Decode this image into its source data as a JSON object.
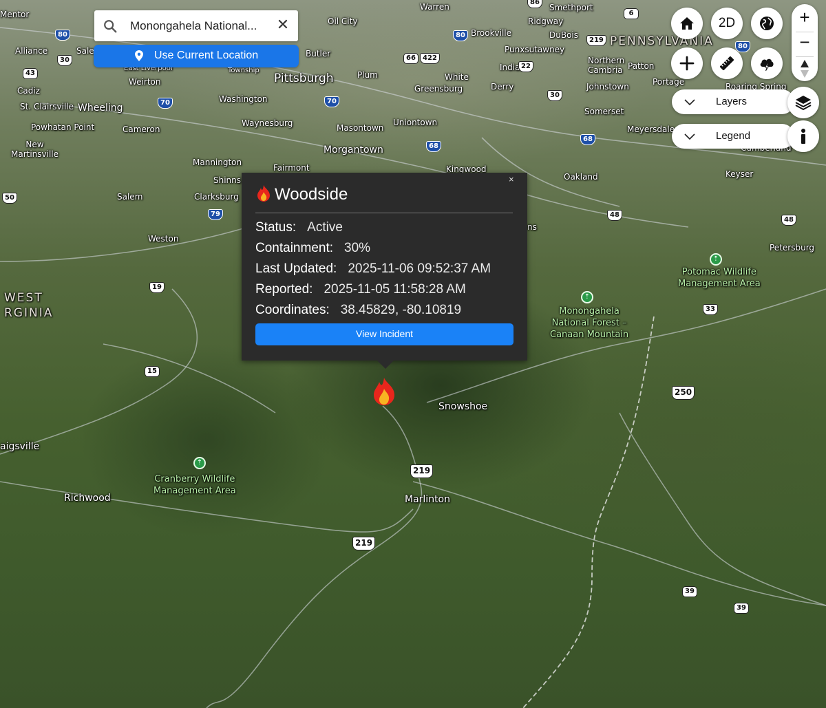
{
  "search": {
    "value": "Monongahela National...",
    "use_location_label": "Use Current Location"
  },
  "controls": {
    "view_mode_label": "2D",
    "layers_label": "Layers",
    "legend_label": "Legend"
  },
  "popup": {
    "title": "Woodside",
    "rows": [
      {
        "label": "Status:",
        "value": "Active"
      },
      {
        "label": "Containment:",
        "value": "30%"
      },
      {
        "label": "Last Updated:",
        "value": "2025-11-06 09:52:37 AM"
      },
      {
        "label": "Reported:",
        "value": "2025-11-05 11:58:28 AM"
      },
      {
        "label": "Coordinates:",
        "value": "38.45829, -80.10819"
      }
    ],
    "button_label": "View Incident",
    "close": "×"
  },
  "places": {
    "mentor": "Mentor",
    "warren": "Warren",
    "smethport": "Smethport",
    "oil_city": "Oil City",
    "ridgway": "Ridgway",
    "brookville": "Brookville",
    "dubois": "DuBois",
    "pennsylvania": "PENNSYLVANIA",
    "alliance": "Alliance",
    "salem_oh": "Salem",
    "butler": "Butler",
    "punxsutawney": "Punxsutawney",
    "northern_cambria": "Northern\nCambria",
    "patton": "Patton",
    "east_liverpool": "East Liverpool",
    "weirton": "Weirton",
    "pittsburgh": "Pittsburgh",
    "plum": "Plum",
    "township": "Township",
    "white": "White",
    "indiana": "Indiana",
    "portage": "Portage",
    "cadiz": "Cadiz",
    "greensburg": "Greensburg",
    "derry": "Derry",
    "johnstown": "Johnstown",
    "roaring_spring": "Roaring Spring",
    "st_clairsville": "St. Clairsville",
    "wheeling": "Wheeling",
    "washington": "Washington",
    "somerset": "Somerset",
    "powhatan_point": "Powhatan Point",
    "cameron": "Cameron",
    "waynesburg": "Waynesburg",
    "uniontown": "Uniontown",
    "masontown": "Masontown",
    "meyersdale": "Meyersdale",
    "new_martinsville": "New\nMartinsville",
    "morgantown": "Morgantown",
    "cumberland": "Cumberland",
    "mannington": "Mannington",
    "fairmont": "Fairmont",
    "kingwood": "Kingwood",
    "oakland": "Oakland",
    "keyser": "Keyser",
    "shinnston": "Shinns",
    "salem_wv": "Salem",
    "clarksburg": "Clarksburg",
    "weston": "Weston",
    "petersburg": "Petersburg",
    "west_virginia": "WEST\nRGINIA",
    "elkins_partial": "ns",
    "snowshoe": "Snowshoe",
    "craigsville": "aigsville",
    "richwood": "Richwood",
    "marlinton": "Marlinton"
  },
  "parks": {
    "potomac": "Potomac Wildlife\nManagement Area",
    "monongahela": "Monongahela\nNational Forest –\nCanaan Mountain",
    "cranberry": "Cranberry Wildlife\nManagement Area"
  },
  "shields": {
    "s6": "6",
    "s86": "86",
    "s80a": "80",
    "s80b": "80",
    "s80c": "80",
    "s30a": "30",
    "s66": "66",
    "s422": "422",
    "s219top": "219",
    "s43": "43",
    "s22": "22",
    "s30b": "30",
    "s70a": "70",
    "s70b": "70",
    "s68a": "68",
    "s68b": "68",
    "s50": "50",
    "s79": "79",
    "s48a": "48",
    "s48b": "48",
    "s19": "19",
    "s33": "33",
    "s15": "15",
    "s250": "250",
    "s219a": "219",
    "s219b": "219",
    "s39a": "39",
    "s39b": "39"
  },
  "colors": {
    "accent": "#1a76e8",
    "popup_bg": "#2b2b2b",
    "view_button": "#1a82f7",
    "fire": "#e8261c"
  },
  "icons": [
    "search-icon",
    "close-icon",
    "location-pin-icon",
    "home-icon",
    "globe-icon",
    "plus-icon",
    "ruler-icon",
    "cloud-lightning-icon",
    "compass-icon",
    "chevron-down-icon",
    "layers-icon",
    "info-icon",
    "fire-icon",
    "park-marker-icon"
  ]
}
